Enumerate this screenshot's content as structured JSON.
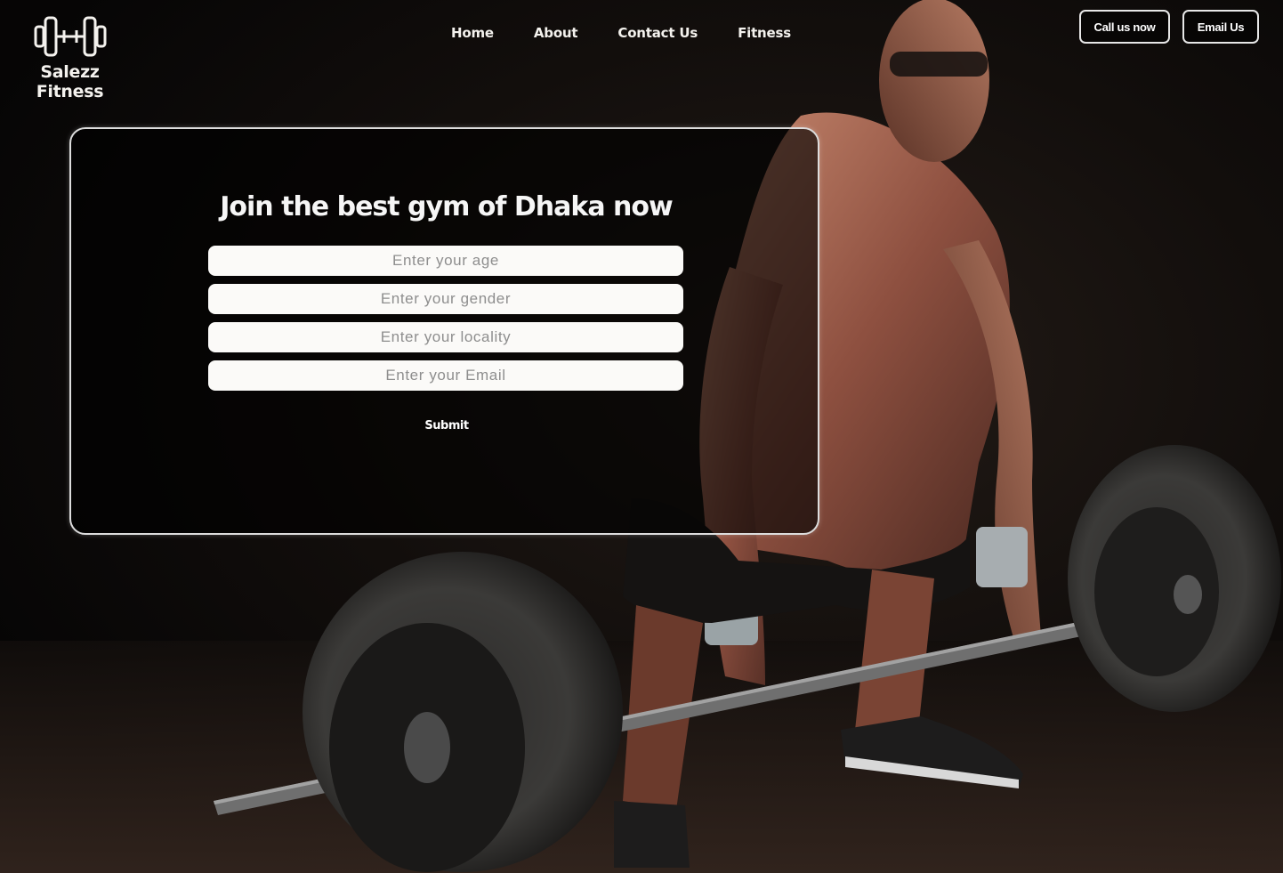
{
  "brand": {
    "name": "Salezz Fitness",
    "icon": "dumbbell-icon"
  },
  "nav": [
    {
      "label": "Home"
    },
    {
      "label": "About"
    },
    {
      "label": "Contact Us"
    },
    {
      "label": "Fitness"
    }
  ],
  "actions": {
    "call_label": "Call us now",
    "email_label": "Email Us"
  },
  "form": {
    "title": "Join the best gym of Dhaka now",
    "age_placeholder": "Enter your age",
    "gender_placeholder": "Enter your gender",
    "locality_placeholder": "Enter your locality",
    "email_placeholder": "Enter your Email",
    "submit_label": "Submit"
  },
  "colors": {
    "background": "#0a0908",
    "text": "#f4f2ee",
    "field": "#fbfaf8",
    "border": "#dcdcdc"
  }
}
